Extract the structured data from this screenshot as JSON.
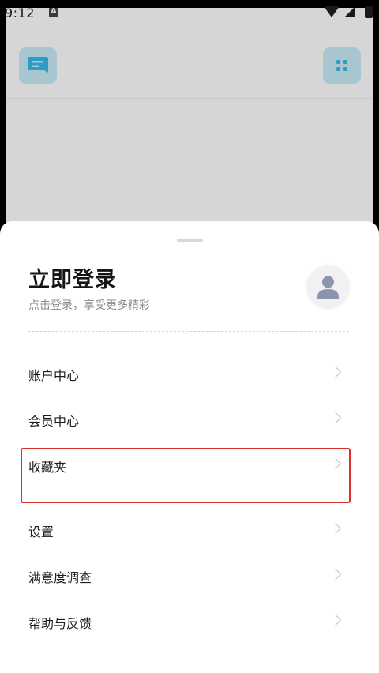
{
  "status_bar": {
    "time": "9:12",
    "notification_icon": "a-icon",
    "wifi_icon": "wifi-icon",
    "signal_icon": "signal-icon",
    "battery_icon": "battery-icon"
  },
  "background_app": {
    "left_button_icon": "chat-icon",
    "right_button_icon": "grid-icon",
    "accent_color": "#2e9cc5"
  },
  "sheet": {
    "title": "立即登录",
    "subtitle": "点击登录，享受更多精彩",
    "avatar_icon": "user-avatar-icon",
    "menu": [
      {
        "label": "账户中心"
      },
      {
        "label": "会员中心"
      },
      {
        "label": "收藏夹"
      },
      {
        "label": "设置"
      },
      {
        "label": "满意度调查"
      },
      {
        "label": "帮助与反馈"
      }
    ],
    "highlight_color": "#d9322a"
  }
}
